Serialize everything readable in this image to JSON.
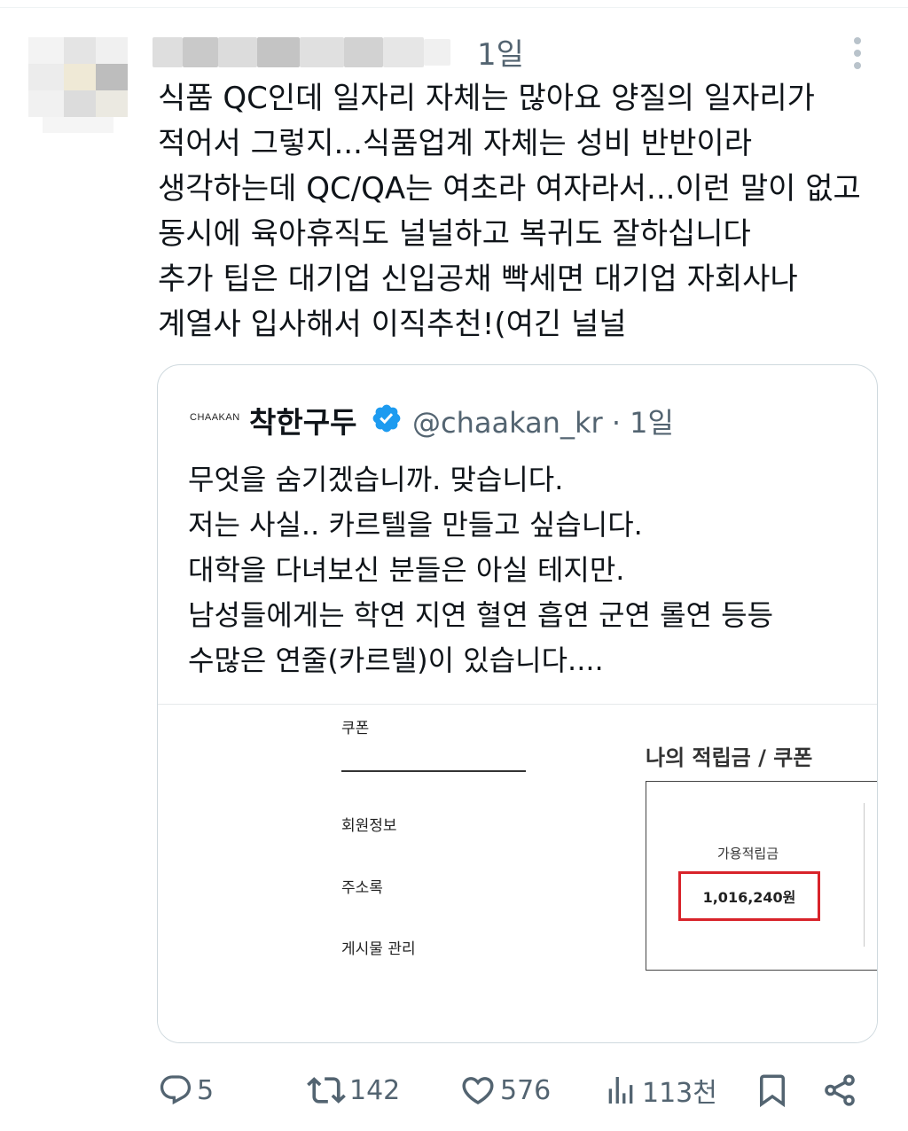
{
  "tweet": {
    "time": "1일",
    "text": "식품 QC인데 일자리 자체는 많아요 양질의 일자리가\n적어서 그렇지...식품업계 자체는 성비 반반이라\n생각하는데 QC/QA는 여초라 여자라서...이런 말이 없고\n동시에 육아휴직도 널널하고 복귀도 잘하십니다\n추가 팁은 대기업 신입공채 빡세면 대기업 자회사나\n계열사 입사해서 이직추천!(여긴 널널"
  },
  "quote": {
    "logo_text": "CHAAKAN",
    "name": "착한구두",
    "handle_time": "@chaakan_kr · 1일",
    "text": "무엇을 숨기겠습니까. 맞습니다.\n저는 사실.. 카르텔을 만들고 싶습니다.\n대학을 다녀보신 분들은 아실 테지만.\n남성들에게는 학연 지연 혈연 흡연 군연 롤연 등등\n수많은 연줄(카르텔)이 있습니다....",
    "image": {
      "menu": [
        "쿠폰",
        "회원정보",
        "주소록",
        "게시물 관리"
      ],
      "panel_title": "나의 적립금 / 쿠폰",
      "points_label": "가용적립금",
      "points_value": "1,016,240원",
      "highlight_color": "#d8232a"
    }
  },
  "actions": {
    "replies": "5",
    "retweets": "142",
    "likes": "576",
    "views": "113천"
  },
  "colors": {
    "text": "#0f1419",
    "secondary": "#536471",
    "verified": "#1d9bf0",
    "border": "#cfd9de"
  }
}
